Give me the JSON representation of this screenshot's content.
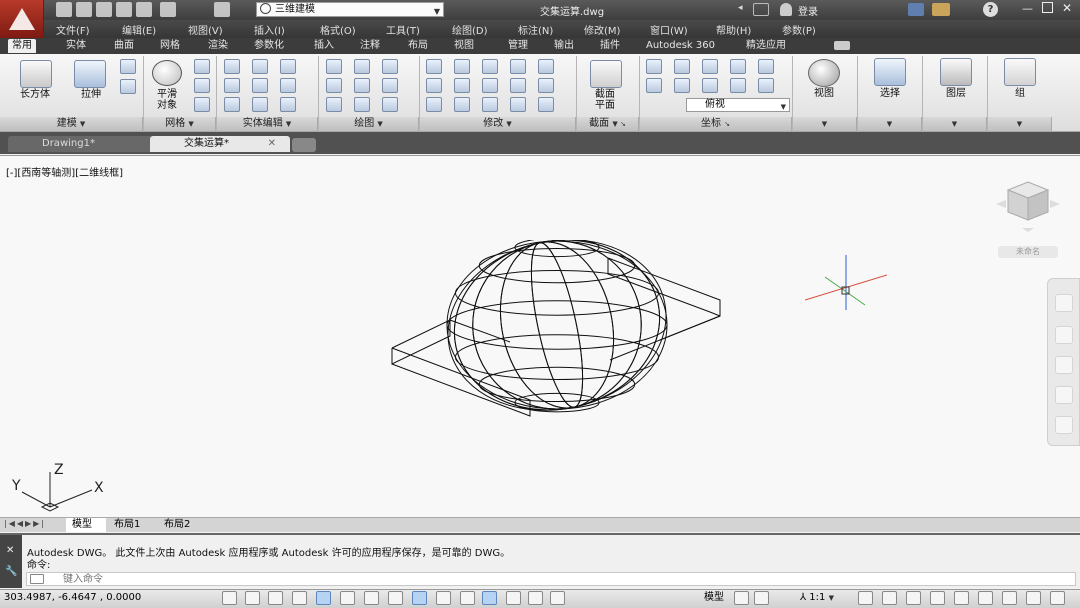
{
  "title_bar": {
    "workspace": "三维建模",
    "document_title": "交集运算.dwg",
    "login_label": "登录",
    "help_label": "?"
  },
  "menu": [
    "文件(F)",
    "编辑(E)",
    "视图(V)",
    "插入(I)",
    "格式(O)",
    "工具(T)",
    "绘图(D)",
    "标注(N)",
    "修改(M)",
    "窗口(W)",
    "帮助(H)",
    "参数(P)"
  ],
  "ribbon_tabs": [
    "常用",
    "实体",
    "曲面",
    "网格",
    "渲染",
    "参数化",
    "插入",
    "注释",
    "布局",
    "视图",
    "管理",
    "输出",
    "插件",
    "Autodesk 360",
    "精选应用"
  ],
  "active_ribbon_tab": "常用",
  "panels": {
    "modeling": {
      "title": "建模",
      "box_label": "长方体",
      "extrude_label": "拉伸"
    },
    "mesh": {
      "title": "网格",
      "smooth_label_1": "平滑",
      "smooth_label_2": "对象"
    },
    "solid_edit": {
      "title": "实体编辑"
    },
    "draw": {
      "title": "绘图"
    },
    "modify": {
      "title": "修改"
    },
    "section": {
      "title": "截面",
      "plane_label_1": "截面",
      "plane_label_2": "平面"
    },
    "coordinates": {
      "title": "坐标",
      "view_select": "俯视"
    },
    "view": {
      "label": "视图"
    },
    "selection": {
      "label": "选择"
    },
    "layers": {
      "label": "图层"
    },
    "groups": {
      "label": "组"
    }
  },
  "doc_tabs": [
    {
      "label": "Drawing1*"
    },
    {
      "label": "交集运算*"
    }
  ],
  "viewport_label": "[-][西南等轴测][二维线框]",
  "viewcube_label": "未命名",
  "ucs": {
    "x": "X",
    "y": "Y",
    "z": "Z"
  },
  "layout_tabs": [
    "模型",
    "布局1",
    "布局2"
  ],
  "command": {
    "history_1": "Autodesk DWG。  此文件上次由 Autodesk 应用程序或 Autodesk 许可的应用程序保存，是可靠的 DWG。",
    "history_2": "命令:",
    "placeholder": "键入命令"
  },
  "status_bar": {
    "coordinates": "303.4987, -6.4647 , 0.0000",
    "model_label": "模型",
    "scale_label": "1:1"
  }
}
